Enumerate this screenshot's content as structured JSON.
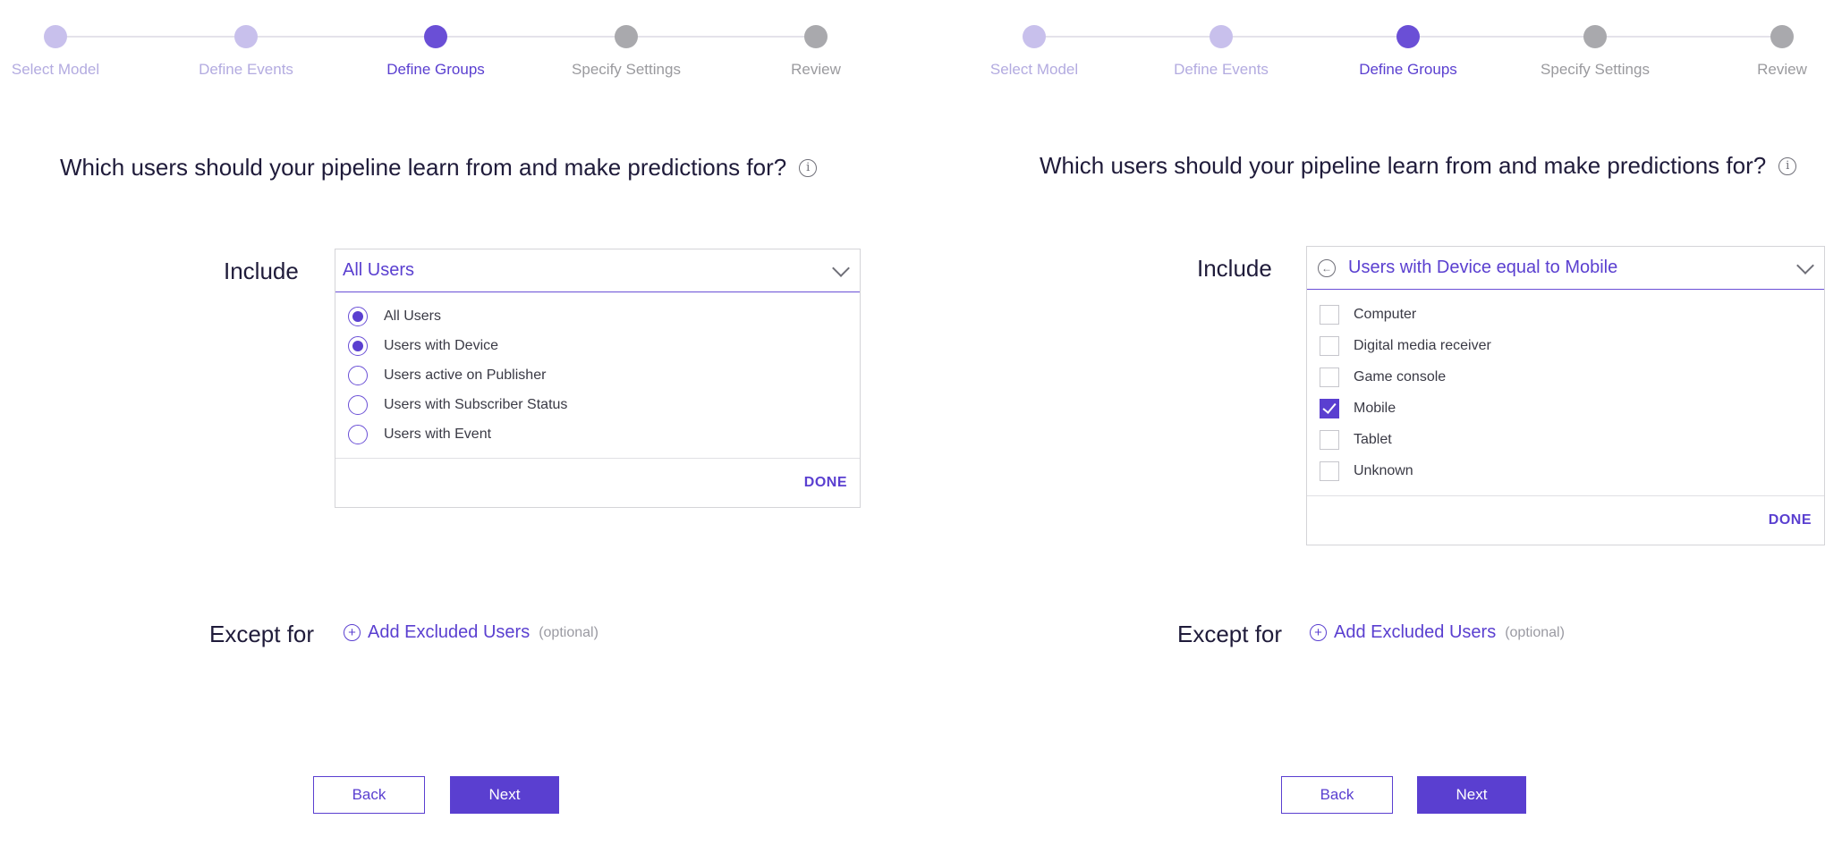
{
  "steps": [
    {
      "label": "Select Model",
      "state": "done"
    },
    {
      "label": "Define Events",
      "state": "done"
    },
    {
      "label": "Define Groups",
      "state": "current"
    },
    {
      "label": "Specify Settings",
      "state": "todo"
    },
    {
      "label": "Review",
      "state": "todo"
    }
  ],
  "left": {
    "question": "Which users should your pipeline learn from and make predictions for?",
    "include_label": "Include",
    "dropdown_value": "All Users",
    "options": [
      {
        "label": "All Users",
        "selected": true
      },
      {
        "label": "Users with Device",
        "selected": true
      },
      {
        "label": "Users active on Publisher",
        "selected": false
      },
      {
        "label": "Users with Subscriber Status",
        "selected": false
      },
      {
        "label": "Users with Event",
        "selected": false
      }
    ],
    "done_label": "DONE",
    "except_label": "Except for",
    "add_excluded_label": "Add Excluded Users",
    "optional_label": "(optional)",
    "back_label": "Back",
    "next_label": "Next"
  },
  "right": {
    "question": "Which users should your pipeline learn from and make predictions for?",
    "include_label": "Include",
    "dropdown_value": "Users with Device equal to Mobile",
    "options": [
      {
        "label": "Computer",
        "checked": false
      },
      {
        "label": "Digital media receiver",
        "checked": false
      },
      {
        "label": "Game console",
        "checked": false
      },
      {
        "label": "Mobile",
        "checked": true
      },
      {
        "label": "Tablet",
        "checked": false
      },
      {
        "label": "Unknown",
        "checked": false
      }
    ],
    "done_label": "DONE",
    "except_label": "Except for",
    "add_excluded_label": "Add Excluded Users",
    "optional_label": "(optional)",
    "back_label": "Back",
    "next_label": "Next"
  },
  "colors": {
    "accent": "#5a3fd0",
    "step_done": "#c8c0ec",
    "step_todo": "#a9a9ad"
  },
  "icons": {
    "info": "info-circle-icon",
    "chevron": "chevron-down-icon",
    "back": "arrow-left-circle-icon",
    "add": "plus-circle-icon"
  }
}
